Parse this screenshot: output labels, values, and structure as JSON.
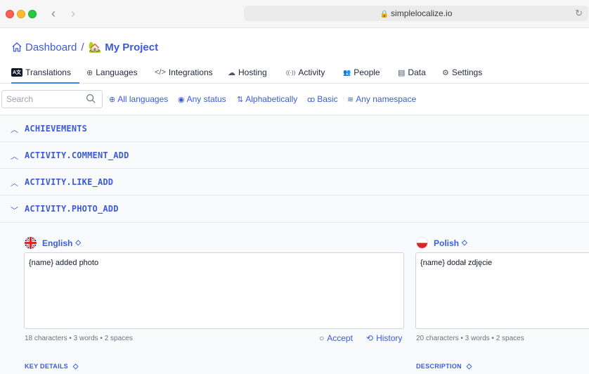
{
  "browser": {
    "url": "simplelocalize.io",
    "back_glyph": "‹",
    "forward_glyph": "›"
  },
  "breadcrumb": {
    "root": "Dashboard",
    "separator": "/",
    "project_icon": "🏡",
    "project": "My Project"
  },
  "tabs": [
    {
      "label": "Translations",
      "icon": "translations-icon",
      "glyph": "A文",
      "active": true
    },
    {
      "label": "Languages",
      "icon": "globe-icon",
      "glyph": "⊕"
    },
    {
      "label": "Integrations",
      "icon": "code-icon",
      "glyph": "</>"
    },
    {
      "label": "Hosting",
      "icon": "cloud-icon",
      "glyph": "☁"
    },
    {
      "label": "Activity",
      "icon": "broadcast-icon",
      "glyph": "((·))"
    },
    {
      "label": "People",
      "icon": "people-icon",
      "glyph": "👥"
    },
    {
      "label": "Data",
      "icon": "database-icon",
      "glyph": "▤"
    },
    {
      "label": "Settings",
      "icon": "gear-icon",
      "glyph": "⚙"
    }
  ],
  "filters": {
    "search_placeholder": "Search",
    "items": [
      {
        "label": "All languages",
        "icon": "globe-icon",
        "glyph": "⊕"
      },
      {
        "label": "Any status",
        "icon": "radio-icon",
        "glyph": "◉"
      },
      {
        "label": "Alphabetically",
        "icon": "sort-icon",
        "glyph": "⇅"
      },
      {
        "label": "Basic",
        "icon": "shapes-icon",
        "glyph": "ꝏ"
      },
      {
        "label": "Any namespace",
        "icon": "layers-icon",
        "glyph": "≋"
      }
    ]
  },
  "keys": [
    {
      "name": "ACHIEVEMENTS",
      "expanded": false,
      "chevron": "^"
    },
    {
      "name": "ACTIVITY.COMMENT_ADD",
      "expanded": false,
      "chevron": "^"
    },
    {
      "name": "ACTIVITY.LIKE_ADD",
      "expanded": false,
      "chevron": "^"
    },
    {
      "name": "ACTIVITY.PHOTO_ADD",
      "expanded": true,
      "chevron": "v"
    }
  ],
  "editor": {
    "source": {
      "language": "English",
      "text": "{name} added photo",
      "stats": "18 characters • 3 words • 2 spaces"
    },
    "target": {
      "language": "Polish",
      "text": "{name} dodał zdjęcie",
      "stats": "20 characters • 3 words • 2 spaces"
    },
    "sort_glyph": "◇",
    "accept_label": "Accept",
    "history_label": "History",
    "key_details_label": "KEY DETAILS",
    "description_label": "DESCRIPTION"
  },
  "colors": {
    "accent": "#3b5bdb",
    "active_tab_underline": "#3b82f6"
  }
}
